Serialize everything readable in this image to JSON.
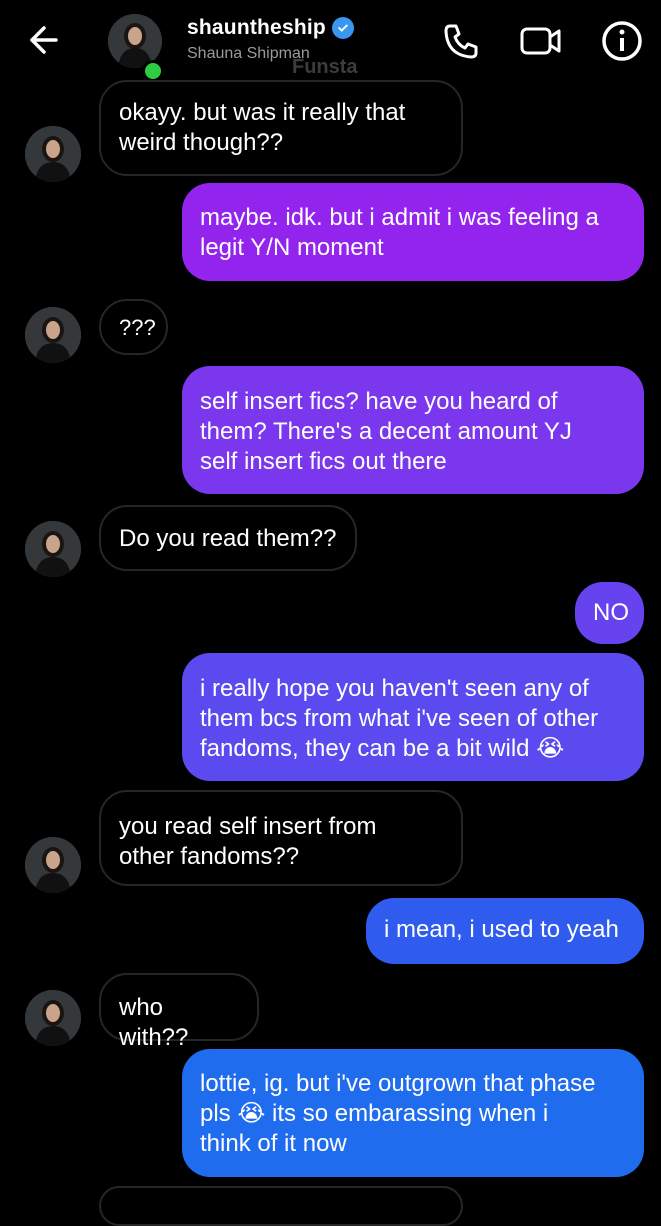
{
  "header": {
    "username": "shauntheship",
    "real_name": "Shauna Shipman",
    "watermark": "Funsta",
    "verified": true
  },
  "messages": [
    {
      "from": "them",
      "text": "okayy. but was it really that\nweird though??"
    },
    {
      "from": "me",
      "text": "maybe. idk. but i admit i was feeling a\nlegit Y/N moment",
      "color": "#9224ee"
    },
    {
      "from": "them",
      "text": "???"
    },
    {
      "from": "me",
      "text": "self insert fics? have you heard of\nthem? There's a decent amount YJ\nself insert fics out there",
      "color": "#7a37ee"
    },
    {
      "from": "them",
      "text": "Do you read them??"
    },
    {
      "from": "me",
      "text": "NO",
      "color": "#6643ee"
    },
    {
      "from": "me",
      "text": "i really hope you haven't seen any of\nthem bcs from what i've seen of other\nfandoms, they can be a bit wild 😭",
      "color": "#5b4aef"
    },
    {
      "from": "them",
      "text": "you read self insert from\nother fandoms??"
    },
    {
      "from": "me",
      "text": "i mean, i used to yeah",
      "color": "#2f5cef"
    },
    {
      "from": "them",
      "text": "who with??"
    },
    {
      "from": "me",
      "text": "lottie, ig. but i've outgrown that phase\npls 😭 its so embarassing when i\nthink of it now",
      "color": "#1f6cee"
    }
  ],
  "icons": {
    "back": "arrow-left-icon",
    "call": "phone-icon",
    "video": "video-camera-icon",
    "info": "info-icon"
  }
}
